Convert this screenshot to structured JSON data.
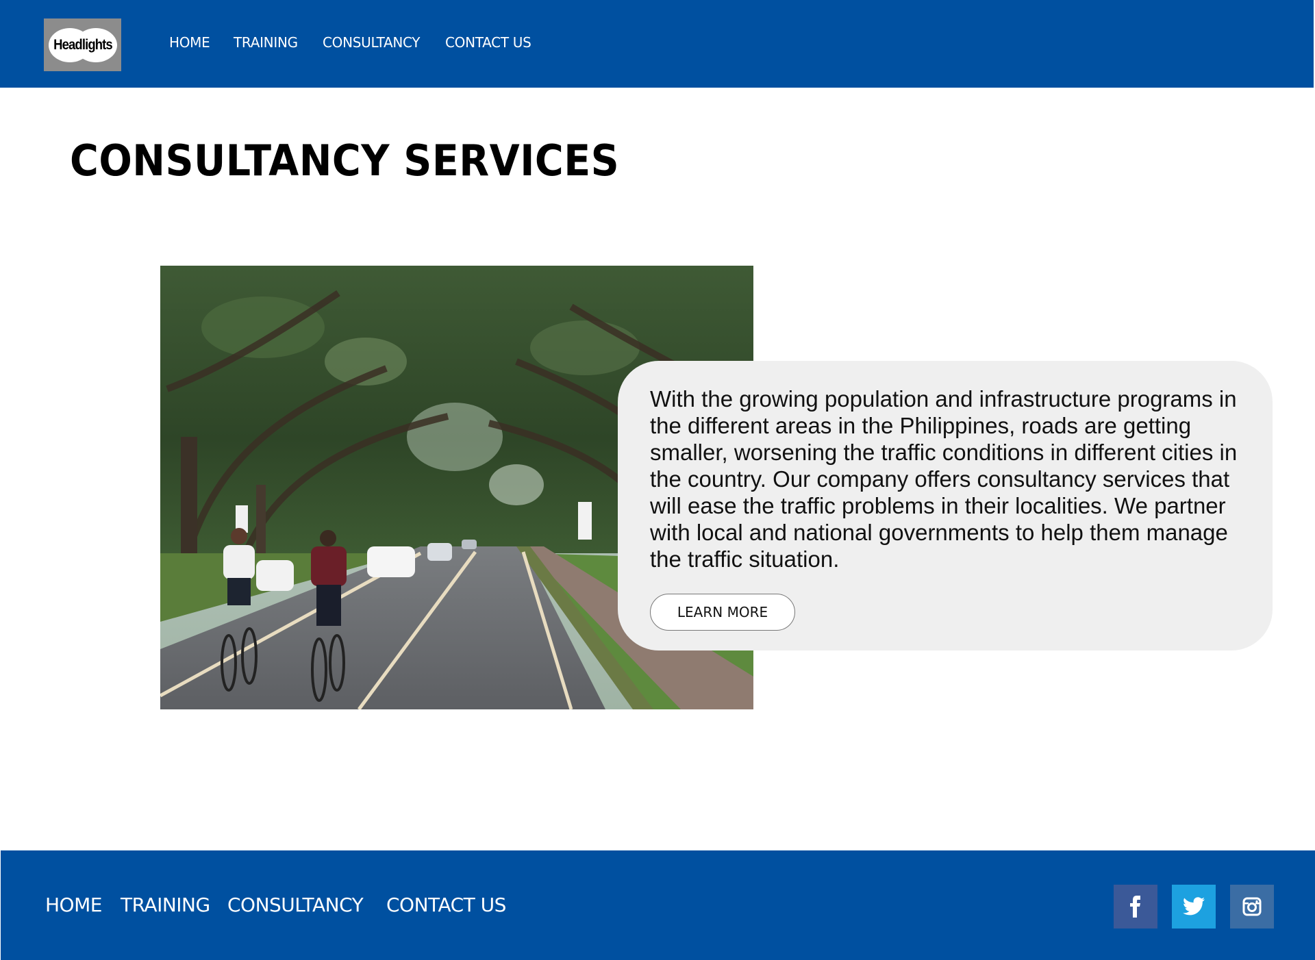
{
  "header": {
    "logo_text": "Headlights",
    "nav": [
      {
        "label": "HOME"
      },
      {
        "label": "TRAINING"
      },
      {
        "label": "CONSULTANCY"
      },
      {
        "label": "CONTACT US"
      }
    ]
  },
  "main": {
    "title": "CONSULTANCY SERVICES",
    "photo": "Tree-lined road with two cyclists and cars",
    "card": {
      "text": "With the growing population and infrastructure programs in the different areas in the Philippines, roads are getting smaller, worsening the traffic conditions in different cities in the country. Our company offers consultancy services that will ease the traffic problems in their localities. We partner with local and national governments to help them manage the traffic situation.",
      "button_label": "LEARN MORE"
    }
  },
  "footer": {
    "nav": [
      {
        "label": "HOME"
      },
      {
        "label": "TRAINING"
      },
      {
        "label": "CONSULTANCY"
      },
      {
        "label": "CONTACT US"
      }
    ],
    "social": [
      {
        "icon": "facebook-icon",
        "color": "#3b5998"
      },
      {
        "icon": "twitter-icon",
        "color": "#1da1e0"
      },
      {
        "icon": "instagram-icon",
        "color": "#3b6da4"
      }
    ]
  },
  "colors": {
    "brand_blue": "#0050a0",
    "card_bg": "#efefef"
  }
}
